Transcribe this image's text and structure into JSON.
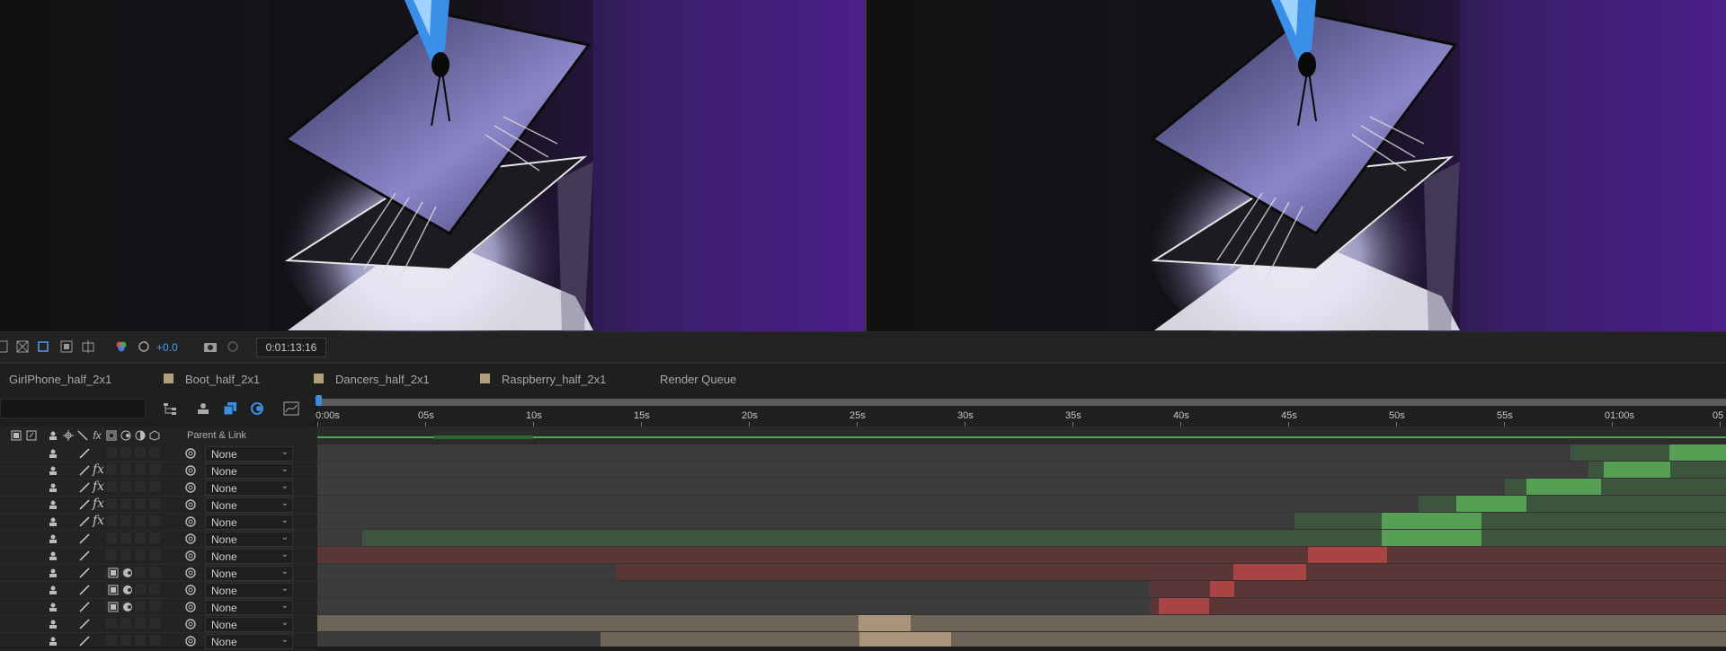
{
  "toolbar": {
    "exposure_value": "+0.0",
    "timecode": "0:01:13:16",
    "icons": [
      "snapshot-icon",
      "grid-icon",
      "region-icon",
      "transparency-icon",
      "3d-view-icon",
      "channel-icon",
      "reset-exposure-icon",
      "camera-icon",
      "show-snapshot-icon"
    ]
  },
  "tabs": [
    {
      "label": "GirlPhone_half_2x1",
      "swatch": false
    },
    {
      "label": "Boot_half_2x1",
      "swatch": true
    },
    {
      "label": "Dancers_half_2x1",
      "swatch": true
    },
    {
      "label": "Raspberry_half_2x1",
      "swatch": true
    },
    {
      "label": "Render Queue",
      "swatch": false
    }
  ],
  "ruler": {
    "ticks": [
      "0:00s",
      "05s",
      "10s",
      "15s",
      "20s",
      "25s",
      "30s",
      "35s",
      "40s",
      "45s",
      "50s",
      "55s",
      "01:00s",
      "05"
    ]
  },
  "columns": {
    "parent_link": "Parent & Link"
  },
  "layers": [
    {
      "parent": "None",
      "fx": false,
      "extra": false
    },
    {
      "parent": "None",
      "fx": true,
      "extra": false
    },
    {
      "parent": "None",
      "fx": true,
      "extra": false
    },
    {
      "parent": "None",
      "fx": true,
      "extra": false
    },
    {
      "parent": "None",
      "fx": true,
      "extra": false
    },
    {
      "parent": "None",
      "fx": false,
      "extra": false
    },
    {
      "parent": "None",
      "fx": false,
      "extra": false
    },
    {
      "parent": "None",
      "fx": false,
      "extra": true
    },
    {
      "parent": "None",
      "fx": false,
      "extra": true
    },
    {
      "parent": "None",
      "fx": false,
      "extra": true
    },
    {
      "parent": "None",
      "fx": false,
      "extra": false
    },
    {
      "parent": "None",
      "fx": false,
      "extra": false
    }
  ],
  "colors": {
    "accent_blue": "#4f9cf5",
    "green_layer": "#55a055",
    "red_layer": "#a84444",
    "tan_layer": "#8c7e6a",
    "label_tan": "#b29f7a"
  }
}
